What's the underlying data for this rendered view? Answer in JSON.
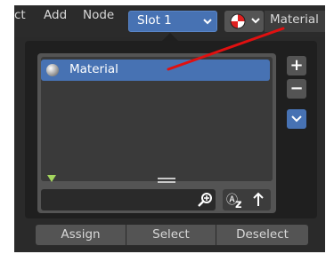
{
  "header": {
    "menu_partial": "ct",
    "menu_add": "Add",
    "menu_node": "Node",
    "slot_label": "Slot 1",
    "material_label": "Material"
  },
  "slots_list": {
    "items": [
      {
        "label": "Material",
        "selected": true
      }
    ]
  },
  "footer": {
    "assign_label": "Assign",
    "select_label": "Select",
    "deselect_label": "Deselect"
  },
  "colors": {
    "accent_blue": "#4772b3",
    "annotation_red": "#e01010"
  }
}
